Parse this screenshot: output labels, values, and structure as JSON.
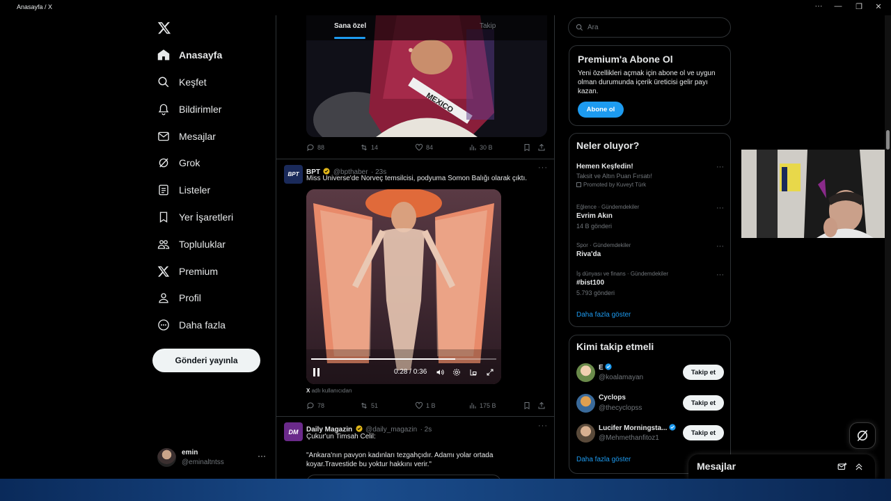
{
  "window": {
    "title": "Anasayfa / X",
    "controls": [
      "···",
      "—",
      "❐",
      "✕"
    ]
  },
  "nav": {
    "items": [
      {
        "label": "Anasayfa",
        "icon": "home-icon",
        "active": true
      },
      {
        "label": "Keşfet",
        "icon": "search-icon"
      },
      {
        "label": "Bildirimler",
        "icon": "bell-icon"
      },
      {
        "label": "Mesajlar",
        "icon": "mail-icon"
      },
      {
        "label": "Grok",
        "icon": "grok-icon"
      },
      {
        "label": "Listeler",
        "icon": "list-icon"
      },
      {
        "label": "Yer İşaretleri",
        "icon": "bookmark-icon"
      },
      {
        "label": "Topluluklar",
        "icon": "communities-icon"
      },
      {
        "label": "Premium",
        "icon": "x-logo-icon"
      },
      {
        "label": "Profil",
        "icon": "person-icon"
      },
      {
        "label": "Daha fazla",
        "icon": "more-circle-icon"
      }
    ],
    "post_button": "Gönderi yayınla"
  },
  "account": {
    "name": "emin",
    "handle": "@eminaltntss",
    "more": "···"
  },
  "feed": {
    "tabs": [
      "Sana özel",
      "Takip"
    ],
    "media_caption": "MEXICO",
    "tweet1_actions": {
      "replies": "88",
      "reposts": "14",
      "likes": "84",
      "views": "30 B"
    },
    "tweet2": {
      "name": "BPT",
      "avatar_text": "BPT",
      "handle": "@bpthaber",
      "time": "· 23s",
      "text": "Miss Universe'de Norveç temsilcisi, podyuma Somon Balığı olarak çıktı.",
      "video_time": "0:28 / 0:36",
      "video_progress": 0.78,
      "source_x": "X",
      "source": "adlı kullanıcıdan",
      "actions": {
        "replies": "78",
        "reposts": "51",
        "likes": "1 B",
        "views": "175 B"
      }
    },
    "tweet3": {
      "name": "Daily Magazin",
      "avatar_text": "DM",
      "handle": "@daily_magazin",
      "time": "· 2s",
      "line1": "Çukur'un Timsah Celil:",
      "line2": "\"Ankara'nın pavyon kadınları tezgahçıdır. Adamı yolar ortada",
      "line3": "koyar.Travestide bu yoktur hakkını verir.\""
    },
    "more": "···"
  },
  "search": {
    "placeholder": "Ara"
  },
  "premium": {
    "title": "Premium'a Abone Ol",
    "body": "Yeni özellikleri açmak için abone ol ve uygun olman durumunda içerik üreticisi gelir payı kazan.",
    "button": "Abone ol"
  },
  "trends": {
    "title": "Neler oluyor?",
    "items": [
      {
        "category": "",
        "title": "Hemen Keşfedin!",
        "subtitle": "Taksit ve Altın Puan Fırsatı!",
        "promoted": "Promoted by Kuveyt Türk"
      },
      {
        "category": "Eğlence · Gündemdekiler",
        "title": "Evrim Akın",
        "subtitle": "14 B gönderi"
      },
      {
        "category": "Spor · Gündemdekiler",
        "title": "Riva'da",
        "subtitle": ""
      },
      {
        "category": "İş dünyası ve finans · Gündemdekiler",
        "title": "#bist100",
        "subtitle": "5.793 gönderi"
      }
    ],
    "show_more": "Daha fazla göster",
    "more": "···"
  },
  "who_to_follow": {
    "title": "Kimi takip etmeli",
    "items": [
      {
        "name": "E",
        "handle": "@koalamayan",
        "button": "Takip et"
      },
      {
        "name": "Cyclops",
        "handle": "@thecyclopss",
        "button": "Takip et"
      },
      {
        "name": "Lucifer Morningsta...",
        "handle": "@Mehmethanfitoz1",
        "button": "Takip et"
      }
    ],
    "show_more": "Daha fazla göster"
  },
  "messages_dock": {
    "title": "Mesajlar"
  },
  "colors": {
    "accent": "#1d9bf0",
    "background": "#000000",
    "border": "#2f3336",
    "muted": "#71767b"
  }
}
